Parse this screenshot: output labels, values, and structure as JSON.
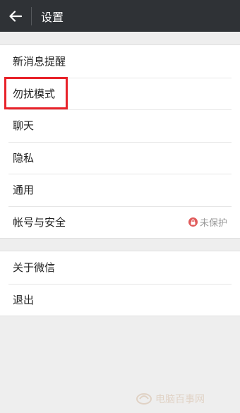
{
  "header": {
    "title": "设置",
    "back_icon": "arrow-left-icon"
  },
  "group1": {
    "items": [
      {
        "label": "新消息提醒"
      },
      {
        "label": "勿扰模式"
      },
      {
        "label": "聊天"
      },
      {
        "label": "隐私"
      },
      {
        "label": "通用"
      },
      {
        "label": "帐号与安全",
        "status": "未保护",
        "status_icon": "lock-icon"
      }
    ]
  },
  "group2": {
    "items": [
      {
        "label": "关于微信"
      },
      {
        "label": "退出"
      }
    ]
  },
  "colors": {
    "header_bg": "#2f3236",
    "page_bg": "#eeeeee",
    "highlight": "#e8232a",
    "lock_badge": "#e05a5a"
  },
  "watermark": {
    "text": "电脑百事网"
  }
}
